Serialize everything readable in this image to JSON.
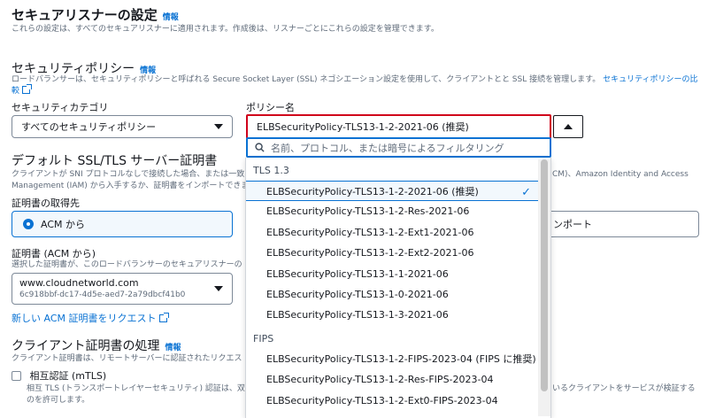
{
  "header": {
    "title": "セキュアリスナーの設定",
    "info": "情報",
    "description": "これらの設定は、すべてのセキュアリスナーに適用されます。作成後は、リスナーごとにこれらの設定を管理できます。"
  },
  "policy_section": {
    "title": "セキュリティポリシー",
    "info": "情報",
    "description_line1": "ロードバランサーは、セキュリティポリシーと呼ばれる Secure Socket Layer (SSL) ネゴシエーション設定を使用して、クライアントとと SSL 接続を管理します。",
    "link_part1": "セキュリティポリシーの比",
    "link_part2": "較",
    "category_label": "セキュリティカテゴリ",
    "category_value": "すべてのセキュリティポリシー",
    "policy_label": "ポリシー名",
    "policy_value": "ELBSecurityPolicy-TLS13-1-2-2021-06 (推奨)",
    "filter_placeholder": "名前、プロトコル、または暗号によるフィルタリング"
  },
  "cert_section": {
    "title": "デフォルト SSL/TLS サーバー証明書",
    "desc1": "クライアントが SNI プロトコルなしで接続した場合、または一致",
    "desc1_right": "CM)、Amazon Identity and Access",
    "desc2": "Management (IAM) から入手するか、証明書をインポートできます",
    "source_label": "証明書の取得先",
    "source_acm": "ACM から",
    "import_partial": "ンポート",
    "cert_label": "証明書 (ACM から)",
    "cert_desc": "選択した証明書が、このロードバランサーのセキュアリスナーの",
    "cert_domain": "www.cloudnetworld.com",
    "cert_id": "6c918bbf-dc17-4d5e-aed7-2a79dbcf41b0",
    "request_link": "新しい ACM 証明書をリクエスト"
  },
  "client_section": {
    "title": "クライアント証明書の処理",
    "info": "情報",
    "desc": "クライアント証明書は、リモートサーバーに認証されたリクエス",
    "mtls_label": "相互認証 (mTLS)",
    "mtls_desc1": "相互 TLS (トランスポートレイヤーセキュリティ) 認証は、双方",
    "mtls_desc1_right": "いるクライアントをサービスが検証する",
    "mtls_desc2": "のを許可します。"
  },
  "dropdown": {
    "group_tls13": "TLS 1.3",
    "group_fips": "FIPS",
    "tls13_options": [
      "ELBSecurityPolicy-TLS13-1-2-2021-06 (推奨)",
      "ELBSecurityPolicy-TLS13-1-2-Res-2021-06",
      "ELBSecurityPolicy-TLS13-1-2-Ext1-2021-06",
      "ELBSecurityPolicy-TLS13-1-2-Ext2-2021-06",
      "ELBSecurityPolicy-TLS13-1-1-2021-06",
      "ELBSecurityPolicy-TLS13-1-0-2021-06",
      "ELBSecurityPolicy-TLS13-1-3-2021-06"
    ],
    "fips_options": [
      "ELBSecurityPolicy-TLS13-1-2-FIPS-2023-04 (FIPS に推奨)",
      "ELBSecurityPolicy-TLS13-1-2-Res-FIPS-2023-04",
      "ELBSecurityPolicy-TLS13-1-2-Ext0-FIPS-2023-04"
    ]
  },
  "colors": {
    "link": "#0972d3",
    "highlight_border": "#d0021b",
    "text": "#16191f",
    "muted": "#5f6b7a"
  }
}
